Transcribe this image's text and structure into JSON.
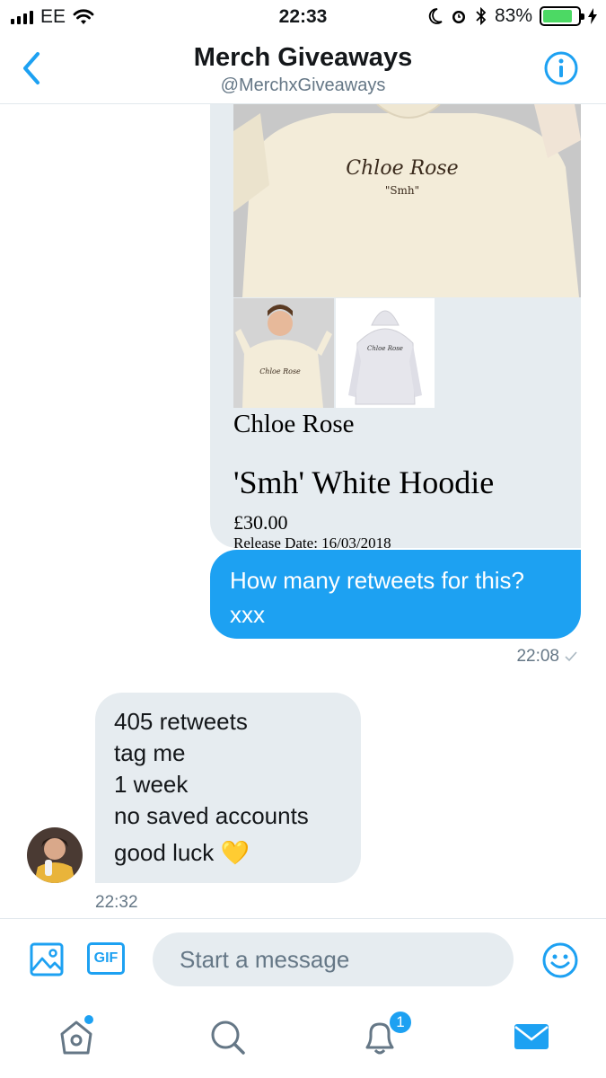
{
  "status_bar": {
    "carrier": "EE",
    "time": "22:33",
    "battery_percent": "83%",
    "battery_level": 0.83
  },
  "header": {
    "title": "Merch Giveaways",
    "handle": "@MerchxGiveaways"
  },
  "card": {
    "hoodie_print_script": "Chloe Rose",
    "hoodie_print_sub": "\"Smh\"",
    "brand": "Chloe Rose",
    "product": "'Smh' White Hoodie",
    "price": "£30.00",
    "release": "Release Date: 16/03/2018"
  },
  "sent_message": {
    "text": "How many retweets for this? xxx",
    "time": "22:08",
    "status_icon": "check-icon"
  },
  "received_message": {
    "lines": [
      "405 retweets",
      "tag me",
      "1 week",
      "no saved accounts",
      "good luck 💛"
    ],
    "time": "22:32"
  },
  "composer": {
    "gif_label": "GIF",
    "placeholder": "Start a message"
  },
  "tabbar": {
    "notification_count": "1"
  },
  "colors": {
    "accent": "#1da1f2",
    "bubble_grey": "#e6ecf0",
    "meta_text": "#657786"
  }
}
